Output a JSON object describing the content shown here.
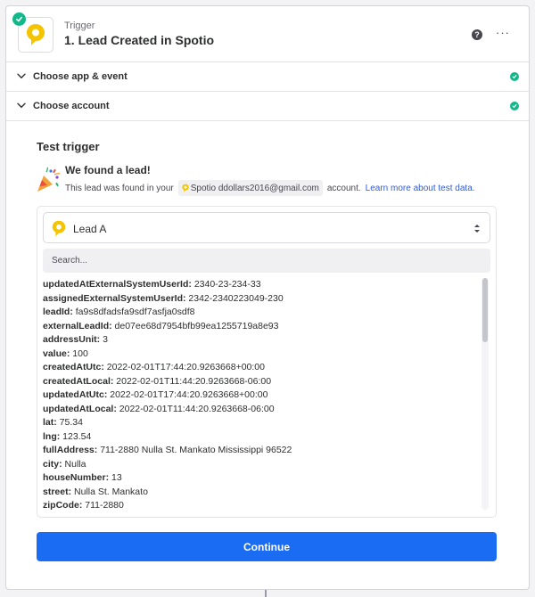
{
  "header": {
    "step_type": "Trigger",
    "title": "1. Lead Created in Spotio",
    "help_label": "?",
    "more_label": "···"
  },
  "sections": [
    {
      "label": "Choose app & event"
    },
    {
      "label": "Choose account"
    }
  ],
  "test": {
    "title": "Test trigger",
    "found_title": "We found a lead!",
    "found_prefix": "This lead was found in your",
    "account_name": "Spotio ddollars2016@gmail.com",
    "found_suffix": "account.",
    "learn_more": "Learn more about test data."
  },
  "sample": {
    "selected": "Lead A",
    "search_placeholder": "Search...",
    "fields": [
      {
        "key": "updatedAtExternalSystemUserId:",
        "value": "2340-23-234-33"
      },
      {
        "key": "assignedExternalSystemUserId:",
        "value": "2342-2340223049-230"
      },
      {
        "key": "leadId:",
        "value": "fa9s8dfadsfa9sdf7asfja0sdf8"
      },
      {
        "key": "externalLeadId:",
        "value": "de07ee68d7954bfb99ea1255719a8e93"
      },
      {
        "key": "addressUnit:",
        "value": "3"
      },
      {
        "key": "value:",
        "value": "100"
      },
      {
        "key": "createdAtUtc:",
        "value": "2022-02-01T17:44:20.9263668+00:00"
      },
      {
        "key": "createdAtLocal:",
        "value": "2022-02-01T11:44:20.9263668-06:00"
      },
      {
        "key": "updatedAtUtc:",
        "value": "2022-02-01T17:44:20.9263668+00:00"
      },
      {
        "key": "updatedAtLocal:",
        "value": "2022-02-01T11:44:20.9263668-06:00"
      },
      {
        "key": "lat:",
        "value": "75.34"
      },
      {
        "key": "lng:",
        "value": "123.54"
      },
      {
        "key": "fullAddress:",
        "value": "711-2880 Nulla St. Mankato Mississippi 96522"
      },
      {
        "key": "city:",
        "value": "Nulla"
      },
      {
        "key": "houseNumber:",
        "value": "13"
      },
      {
        "key": "street:",
        "value": "Nulla St. Mankato"
      },
      {
        "key": "zipCode:",
        "value": "711-2880"
      }
    ]
  },
  "continue_label": "Continue",
  "colors": {
    "success": "#13b88a",
    "primary": "#1a6cf2",
    "spotio_yellow": "#f5c400"
  },
  "icons": {
    "status": "check-circle-icon",
    "app": "spotio-pin-icon",
    "help": "help-icon",
    "more": "more-icon",
    "expand": "chevron-down-icon",
    "section_ok": "check-circle-icon",
    "celebrate": "party-popper-icon",
    "select": "select-arrows-icon"
  }
}
